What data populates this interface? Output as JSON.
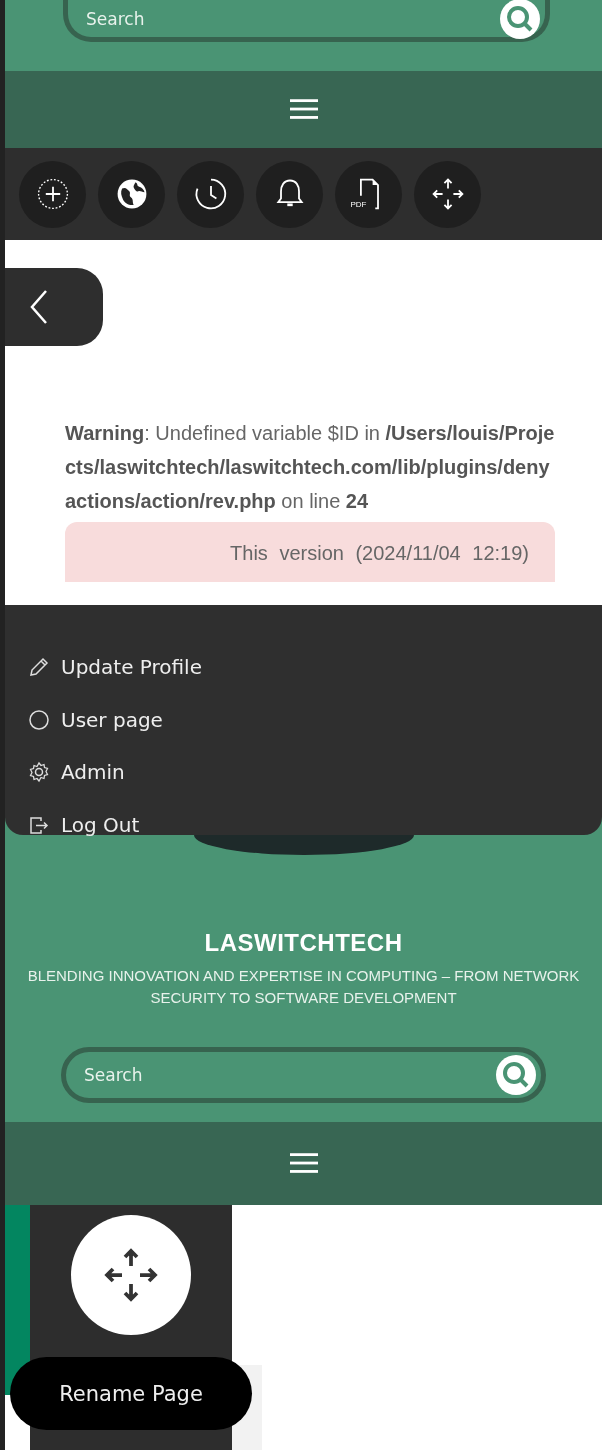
{
  "top_header": {
    "search": {
      "placeholder": "Search"
    }
  },
  "toolbar": {
    "buttons": [
      {
        "kind": "add"
      },
      {
        "kind": "globe"
      },
      {
        "kind": "history"
      },
      {
        "kind": "bell"
      },
      {
        "kind": "pdf",
        "label": "PDF"
      },
      {
        "kind": "move"
      }
    ]
  },
  "notice": {
    "warning": "**Warning**: Undefined variable $ID in **/Users/louis/Projects/laswitchtech/laswitchtech.com/lib/plugins/denyactions/action/rev.php** on line **24**",
    "revision": "This version (2024/11/04 12:19)"
  },
  "user_menu": {
    "items": [
      {
        "kind": "edit",
        "label": "Update Profile"
      },
      {
        "kind": "user",
        "label": "User page"
      },
      {
        "kind": "admin",
        "label": "Admin"
      },
      {
        "kind": "logout",
        "label": "Log Out"
      }
    ]
  },
  "site_header": {
    "title": "LASWITCHTECH",
    "tagline": "BLENDING INNOVATION AND EXPERTISE IN COMPUTING – FROM NETWORK SECURITY TO SOFTWARE DEVELOPMENT",
    "search": {
      "placeholder": "Search"
    }
  },
  "tooltip": {
    "text": "Rename Page"
  }
}
